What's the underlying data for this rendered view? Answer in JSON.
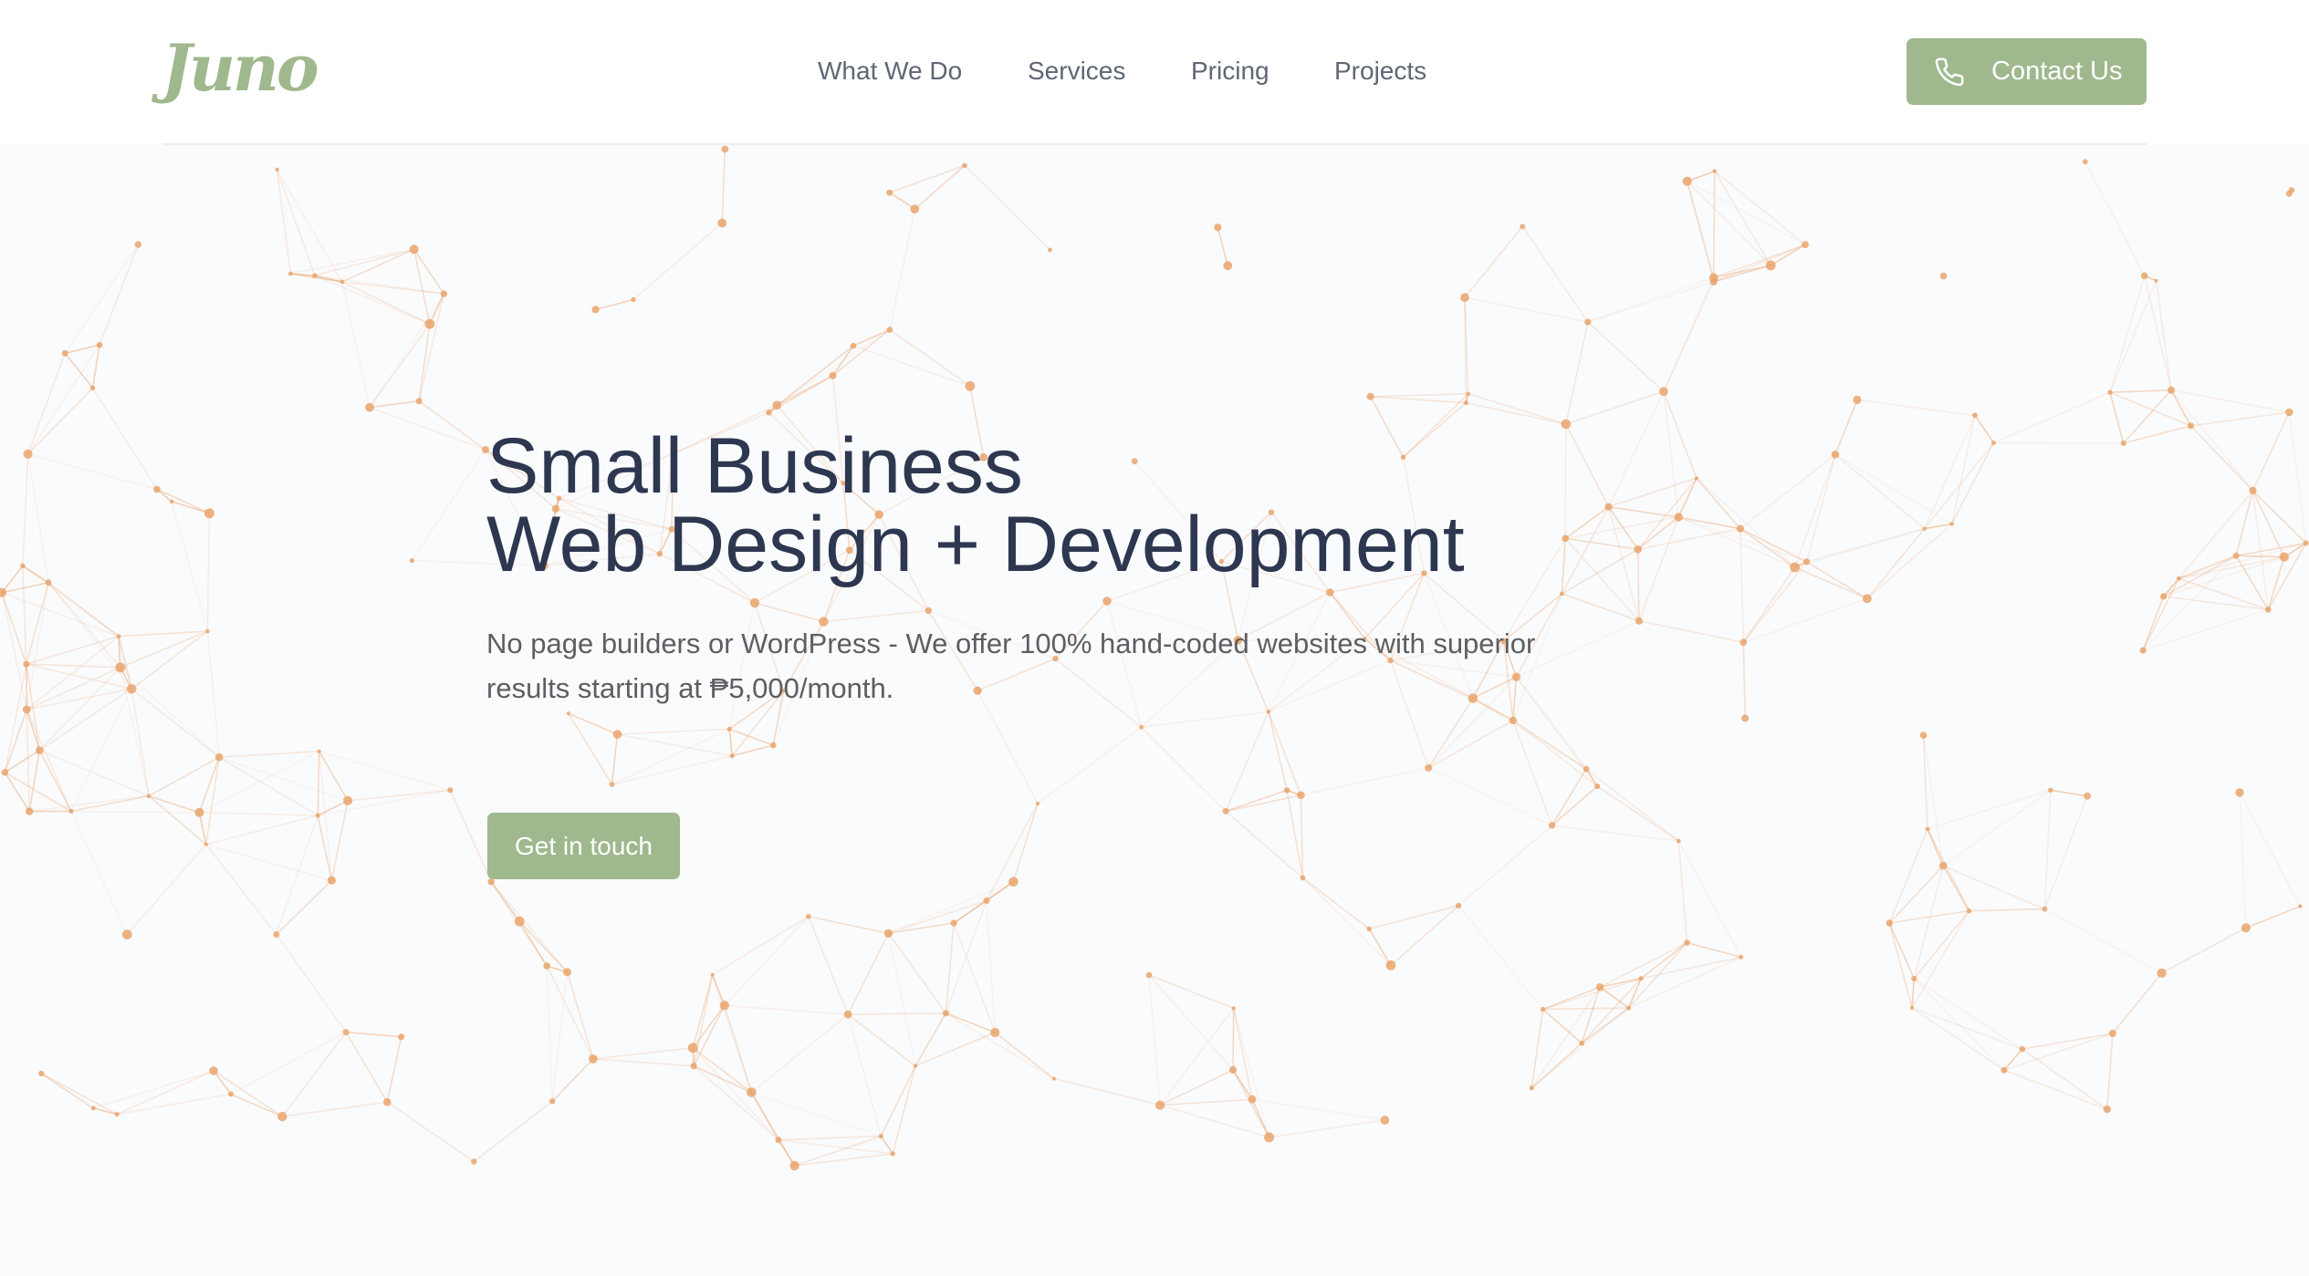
{
  "brand": {
    "logo_text": "Juno",
    "logo_color": "#9fb88d",
    "accent_color": "#9fb88d",
    "particle_color": "#e9a46c"
  },
  "nav": {
    "items": [
      {
        "label": "What We Do"
      },
      {
        "label": "Services"
      },
      {
        "label": "Pricing"
      },
      {
        "label": "Projects"
      }
    ]
  },
  "header": {
    "contact_label": "Contact Us",
    "contact_icon": "phone-icon"
  },
  "hero": {
    "title_line1": "Small Business",
    "title_line2": "Web Design + Development",
    "subtitle": "No page builders or WordPress - We offer 100% hand-coded websites with superior results starting at ₱5,000/month.",
    "cta_label": "Get in touch"
  }
}
